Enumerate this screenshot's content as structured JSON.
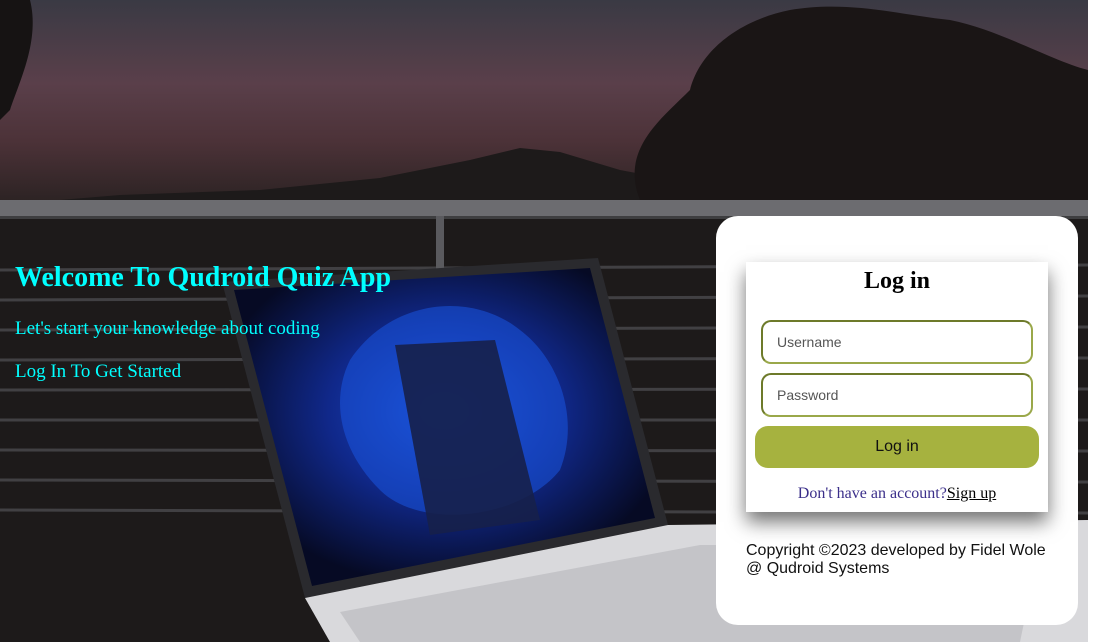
{
  "hero": {
    "title": "Welcome To Qudroid Quiz App",
    "subtitle": "Let's start your knowledge about coding",
    "cta_text": "Log In To Get Started"
  },
  "login_form": {
    "title": "Log in",
    "username_placeholder": "Username",
    "username_value": "",
    "password_placeholder": "Password",
    "password_value": "",
    "submit_label": "Log in",
    "signup_prompt": "Don't have an account?",
    "signup_link": "Sign up"
  },
  "footer": {
    "copyright": "Copyright ©2023 developed by Fidel Wole @ Qudroid Systems"
  },
  "colors": {
    "heading_text": "#00ffff",
    "button_bg": "#a6b23f",
    "field_border": "#9aa84a",
    "signup_prompt": "#3b2f8a"
  },
  "background_image": "dusk-laptop-on-balcony-photo"
}
